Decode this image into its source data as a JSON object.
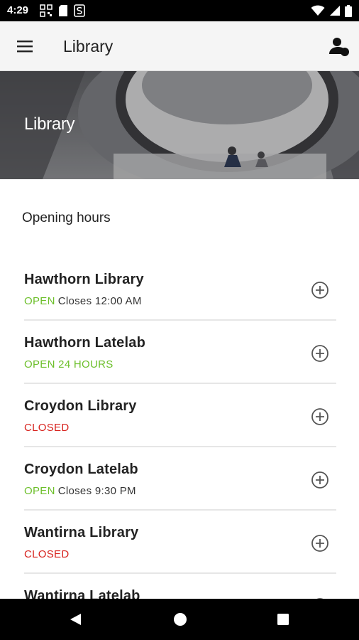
{
  "status_bar": {
    "time": "4:29",
    "left_icons": [
      "qr-code-icon",
      "sd-card-icon",
      "sync-s-icon"
    ],
    "right_icons": [
      "wifi-icon",
      "signal-icon",
      "battery-icon"
    ]
  },
  "app_bar": {
    "title": "Library",
    "menu_icon": "hamburger-menu-icon",
    "profile_icon": "profile-icon"
  },
  "hero": {
    "title": "Library"
  },
  "section": {
    "title": "Opening hours"
  },
  "locations": [
    {
      "name": "Hawthorn Library",
      "status": "OPEN",
      "status_type": "open",
      "detail": "Closes 12:00 AM"
    },
    {
      "name": "Hawthorn Latelab",
      "status": "OPEN 24 HOURS",
      "status_type": "open",
      "detail": ""
    },
    {
      "name": "Croydon Library",
      "status": "CLOSED",
      "status_type": "closed",
      "detail": ""
    },
    {
      "name": "Croydon Latelab",
      "status": "OPEN",
      "status_type": "open",
      "detail": "Closes 9:30 PM"
    },
    {
      "name": "Wantirna Library",
      "status": "CLOSED",
      "status_type": "closed",
      "detail": ""
    },
    {
      "name": "Wantirna Latelab",
      "status": "",
      "status_type": "",
      "detail": ""
    }
  ],
  "colors": {
    "open": "#6cbf2a",
    "closed": "#d7221d",
    "app_bar": "#f5f5f5",
    "system_bars": "#000000"
  },
  "nav_bar": {
    "icons": [
      "back-icon",
      "home-icon",
      "recents-icon"
    ]
  }
}
